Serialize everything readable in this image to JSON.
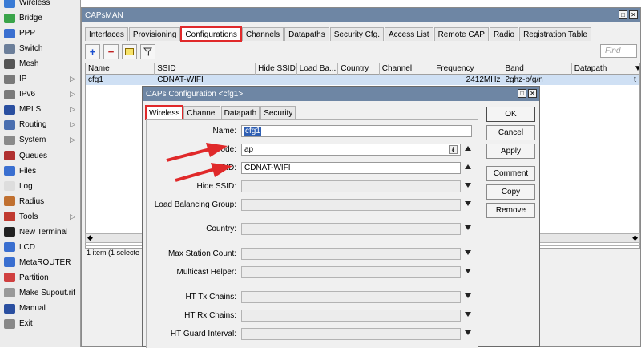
{
  "sidebar": {
    "items": [
      {
        "label": "Wireless",
        "icon": "wireless-icon",
        "color": "#3a7bd5"
      },
      {
        "label": "Bridge",
        "icon": "bridge-icon",
        "color": "#3aa44a"
      },
      {
        "label": "PPP",
        "icon": "ppp-icon",
        "color": "#3a6fd0"
      },
      {
        "label": "Switch",
        "icon": "switch-icon",
        "color": "#6c7f9a"
      },
      {
        "label": "Mesh",
        "icon": "mesh-icon",
        "color": "#555555"
      },
      {
        "label": "IP",
        "icon": "ip-icon",
        "color": "#7a7a7a",
        "arrow": true
      },
      {
        "label": "IPv6",
        "icon": "ipv6-icon",
        "color": "#7a7a7a",
        "arrow": true
      },
      {
        "label": "MPLS",
        "icon": "mpls-icon",
        "color": "#2a4fa0",
        "arrow": true
      },
      {
        "label": "Routing",
        "icon": "routing-icon",
        "color": "#4a6fb0",
        "arrow": true
      },
      {
        "label": "System",
        "icon": "system-icon",
        "color": "#8a8a8a",
        "arrow": true
      },
      {
        "label": "Queues",
        "icon": "queues-icon",
        "color": "#b03030"
      },
      {
        "label": "Files",
        "icon": "files-icon",
        "color": "#3a6fd0"
      },
      {
        "label": "Log",
        "icon": "log-icon",
        "color": "#dddddd"
      },
      {
        "label": "Radius",
        "icon": "radius-icon",
        "color": "#c07030"
      },
      {
        "label": "Tools",
        "icon": "tools-icon",
        "color": "#c03a30",
        "arrow": true
      },
      {
        "label": "New Terminal",
        "icon": "terminal-icon",
        "color": "#222222"
      },
      {
        "label": "LCD",
        "icon": "lcd-icon",
        "color": "#3a6fd0"
      },
      {
        "label": "MetaROUTER",
        "icon": "metarouter-icon",
        "color": "#3a6fd0"
      },
      {
        "label": "Partition",
        "icon": "partition-icon",
        "color": "#d04040"
      },
      {
        "label": "Make Supout.rif",
        "icon": "supout-icon",
        "color": "#999999"
      },
      {
        "label": "Manual",
        "icon": "manual-icon",
        "color": "#2a4fa0"
      },
      {
        "label": "Exit",
        "icon": "exit-icon",
        "color": "#888888"
      }
    ]
  },
  "capsman": {
    "title": "CAPsMAN",
    "tabs": [
      "Interfaces",
      "Provisioning",
      "Configurations",
      "Channels",
      "Datapaths",
      "Security Cfg.",
      "Access List",
      "Remote CAP",
      "Radio",
      "Registration Table"
    ],
    "active_tab": "Configurations",
    "find_placeholder": "Find",
    "columns": [
      "Name",
      "SSID",
      "Hide SSID",
      "Load Ba...",
      "Country",
      "Channel",
      "Frequency",
      "Band",
      "Datapath"
    ],
    "rows": [
      {
        "name": "cfg1",
        "ssid": "CDNAT-WIFI",
        "hide_ssid": "",
        "load_ba": "",
        "country": "",
        "channel": "",
        "frequency": "2412MHz",
        "band": "2ghz-b/g/n",
        "datapath": "",
        "extra": "t"
      }
    ],
    "status": "1 item (1 selecte"
  },
  "dialog": {
    "title": "CAPs Configuration <cfg1>",
    "tabs": [
      "Wireless",
      "Channel",
      "Datapath",
      "Security"
    ],
    "active_tab": "Wireless",
    "fields": {
      "name": {
        "label": "Name:",
        "value": "cfg1"
      },
      "mode": {
        "label": "Mode:",
        "value": "ap"
      },
      "ssid": {
        "label": "SSID:",
        "value": "CDNAT-WIFI"
      },
      "hide_ssid": {
        "label": "Hide SSID:",
        "value": ""
      },
      "load_balancing": {
        "label": "Load Balancing Group:",
        "value": ""
      },
      "country": {
        "label": "Country:",
        "value": ""
      },
      "max_station": {
        "label": "Max Station Count:",
        "value": ""
      },
      "multicast": {
        "label": "Multicast Helper:",
        "value": ""
      },
      "ht_tx": {
        "label": "HT Tx Chains:",
        "value": ""
      },
      "ht_rx": {
        "label": "HT Rx Chains:",
        "value": ""
      },
      "ht_guard": {
        "label": "HT Guard Interval:",
        "value": ""
      }
    },
    "buttons": {
      "ok": "OK",
      "cancel": "Cancel",
      "apply": "Apply",
      "comment": "Comment",
      "copy": "Copy",
      "remove": "Remove"
    }
  },
  "colors": {
    "accent_red": "#e0292a",
    "titlebar": "#6e86a4",
    "selected_row": "#cfe0f4"
  }
}
